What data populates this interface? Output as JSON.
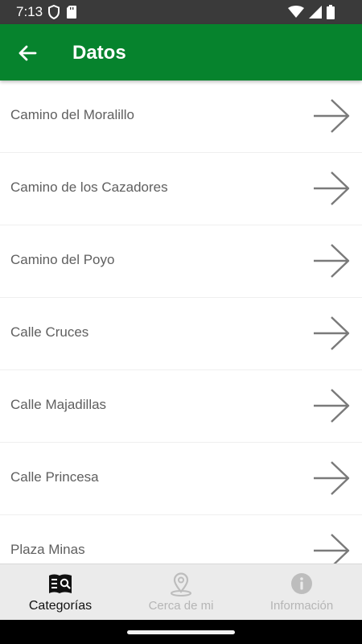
{
  "status_bar": {
    "time": "7:13",
    "icons": [
      "shield-icon",
      "sd-card-icon",
      "wifi-icon",
      "signal-icon",
      "battery-icon"
    ]
  },
  "app_bar": {
    "title": "Datos",
    "back_icon": "back-arrow-icon",
    "color": "#06832d"
  },
  "list": {
    "items": [
      {
        "label": "Camino del Moralillo"
      },
      {
        "label": "Camino de los Cazadores"
      },
      {
        "label": "Camino del Poyo"
      },
      {
        "label": "Calle Cruces"
      },
      {
        "label": "Calle Majadillas"
      },
      {
        "label": "Calle Princesa"
      },
      {
        "label": "Plaza Minas"
      }
    ],
    "item_icon": "arrow-right-icon"
  },
  "bottom_nav": {
    "items": [
      {
        "label": "Categorías",
        "icon": "categories-search-icon",
        "active": true
      },
      {
        "label": "Cerca de mi",
        "icon": "location-pin-icon",
        "active": false
      },
      {
        "label": "Información",
        "icon": "info-icon",
        "active": false
      }
    ]
  }
}
